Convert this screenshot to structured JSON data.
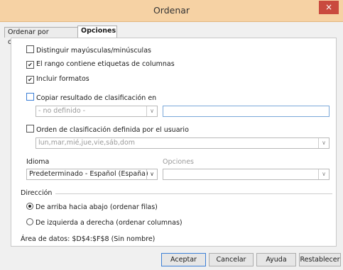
{
  "window": {
    "title": "Ordenar",
    "close_glyph": "×"
  },
  "tabs": [
    {
      "label": "Ordenar por criterios",
      "active": false
    },
    {
      "label": "Opciones",
      "active": true
    }
  ],
  "options": {
    "case_sensitive": {
      "label": "Distinguir mayúsculas/minúsculas",
      "checked": false
    },
    "has_headers": {
      "label": "El rango contiene etiquetas de columnas",
      "checked": true
    },
    "include_formats": {
      "label": "Incluir formatos",
      "checked": true
    },
    "copy_results": {
      "label": "Copiar resultado de clasificación en",
      "checked": false
    },
    "copy_target_select": "- no definido -",
    "copy_target_input": "",
    "custom_order": {
      "label": "Orden de clasificación definida por el usuario",
      "checked": false
    },
    "custom_order_select": "lun,mar,mié,jue,vie,sáb,dom"
  },
  "language": {
    "label": "Idioma",
    "value": "Predeterminado - Español (España)"
  },
  "sort_options": {
    "label": "Opciones",
    "value": ""
  },
  "direction": {
    "label": "Dirección",
    "top_to_bottom": {
      "label": "De arriba hacia abajo (ordenar filas)",
      "selected": true
    },
    "left_to_right": {
      "label": "De izquierda a derecha (ordenar columnas)",
      "selected": false
    }
  },
  "data_area": "Área de datos: $D$4:$F$8 (Sin nombre)",
  "buttons": {
    "accept": "Aceptar",
    "cancel": "Cancelar",
    "help": "Ayuda",
    "reset": "Restablecer"
  },
  "colors": {
    "titlebar": "#f6d2a4",
    "close": "#c94a3e",
    "focus": "#3c7fd6"
  }
}
